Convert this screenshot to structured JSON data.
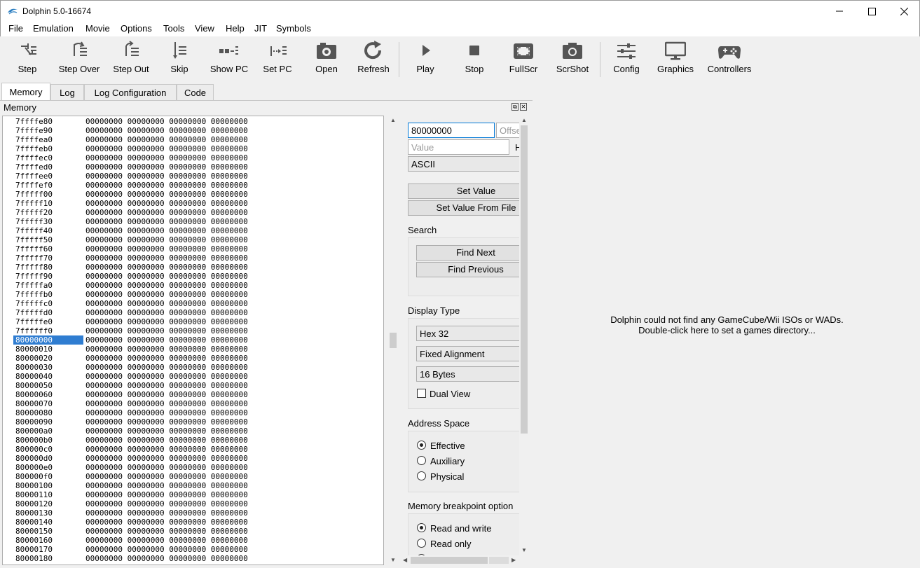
{
  "window": {
    "title": "Dolphin 5.0-16674"
  },
  "menu": [
    "File",
    "Emulation",
    "Movie",
    "Options",
    "Tools",
    "View",
    "Help",
    "JIT",
    "Symbols"
  ],
  "toolbar": {
    "step": "Step",
    "step_over": "Step Over",
    "step_out": "Step Out",
    "skip": "Skip",
    "show_pc": "Show PC",
    "set_pc": "Set PC",
    "open": "Open",
    "refresh": "Refresh",
    "play": "Play",
    "stop": "Stop",
    "fullscr": "FullScr",
    "scrshot": "ScrShot",
    "config": "Config",
    "graphics": "Graphics",
    "controllers": "Controllers"
  },
  "tabs": [
    "Memory",
    "Log",
    "Log Configuration",
    "Code"
  ],
  "dock": {
    "title": "Memory"
  },
  "memory": {
    "selected_address": "80000000",
    "row_values": "00000000 00000000 00000000 00000000",
    "addresses": [
      "7ffffe80",
      "7ffffe90",
      "7ffffea0",
      "7ffffeb0",
      "7ffffec0",
      "7ffffed0",
      "7ffffee0",
      "7ffffef0",
      "7fffff00",
      "7fffff10",
      "7fffff20",
      "7fffff30",
      "7fffff40",
      "7fffff50",
      "7fffff60",
      "7fffff70",
      "7fffff80",
      "7fffff90",
      "7fffffa0",
      "7fffffb0",
      "7fffffc0",
      "7fffffd0",
      "7fffffe0",
      "7ffffff0",
      "80000000",
      "80000010",
      "80000020",
      "80000030",
      "80000040",
      "80000050",
      "80000060",
      "80000070",
      "80000080",
      "80000090",
      "800000a0",
      "800000b0",
      "800000c0",
      "800000d0",
      "800000e0",
      "800000f0",
      "80000100",
      "80000110",
      "80000120",
      "80000130",
      "80000140",
      "80000150",
      "80000160",
      "80000170",
      "80000180"
    ]
  },
  "side": {
    "address_value": "80000000",
    "offset_placeholder": "Offset",
    "value_placeholder": "Value",
    "hex_label": "H",
    "input_type": "ASCII",
    "set_value": "Set Value",
    "set_value_from_file": "Set Value From File",
    "search_label": "Search",
    "find_next": "Find Next",
    "find_previous": "Find Previous",
    "display_type_label": "Display Type",
    "display_type": "Hex 32",
    "alignment": "Fixed Alignment",
    "row_length": "16 Bytes",
    "dual_view": "Dual View",
    "address_space_label": "Address Space",
    "effective": "Effective",
    "auxiliary": "Auxiliary",
    "physical": "Physical",
    "bp_label": "Memory breakpoint option",
    "read_write": "Read and write",
    "read_only": "Read only"
  },
  "gamelist": {
    "line1": "Dolphin could not find any GameCube/Wii ISOs or WADs.",
    "line2": "Double-click here to set a games directory..."
  },
  "colors": {
    "selection": "#2f7dd1",
    "focus_border": "#0078d7"
  }
}
